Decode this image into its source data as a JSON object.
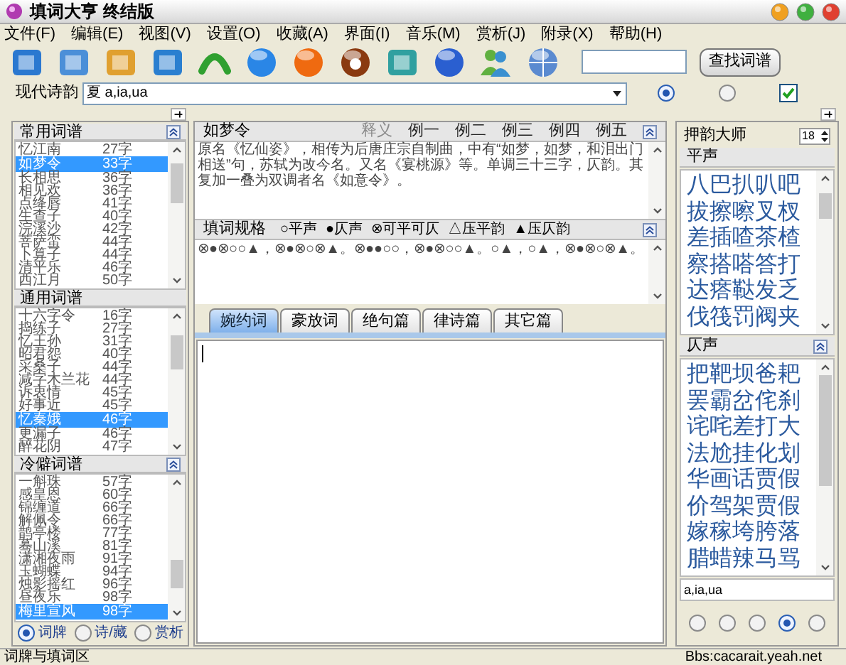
{
  "window": {
    "title": "填词大亨  终结版"
  },
  "menu": [
    "文件(F)",
    "编辑(E)",
    "视图(V)",
    "设置(O)",
    "收藏(A)",
    "界面(I)",
    "音乐(M)",
    "赏析(J)",
    "附录(X)",
    "帮助(H)"
  ],
  "toolbar": {
    "search_button": "查找词谱"
  },
  "rhyme_bar": {
    "label": "现代诗韵",
    "value": "夏 a,ia,ua",
    "options": [
      {
        "kind": "radio",
        "selected": true
      },
      {
        "kind": "radio",
        "selected": false
      },
      {
        "kind": "checkbox",
        "checked": true
      }
    ]
  },
  "left_groups": [
    {
      "title": "常用词谱",
      "items": [
        {
          "name": "忆江南",
          "count": "27字",
          "selected": false
        },
        {
          "name": "如梦令",
          "count": "33字",
          "selected": true
        },
        {
          "name": "长相思",
          "count": "36字",
          "selected": false
        },
        {
          "name": "相见欢",
          "count": "36字",
          "selected": false
        },
        {
          "name": "点绛唇",
          "count": "41字",
          "selected": false
        },
        {
          "name": "生查子",
          "count": "40字",
          "selected": false
        },
        {
          "name": "浣溪沙",
          "count": "42字",
          "selected": false
        },
        {
          "name": "菩萨蛮",
          "count": "44字",
          "selected": false
        },
        {
          "name": "卜算子",
          "count": "44字",
          "selected": false
        },
        {
          "name": "清平乐",
          "count": "46字",
          "selected": false
        },
        {
          "name": "西江月",
          "count": "50字",
          "selected": false
        }
      ]
    },
    {
      "title": "通用词谱",
      "items": [
        {
          "name": "十六字令",
          "count": "16字",
          "selected": false
        },
        {
          "name": "捣练子",
          "count": "27字",
          "selected": false
        },
        {
          "name": "忆王孙",
          "count": "31字",
          "selected": false
        },
        {
          "name": "昭君怨",
          "count": "40字",
          "selected": false
        },
        {
          "name": "采桑子",
          "count": "44字",
          "selected": false
        },
        {
          "name": "减字木兰花",
          "count": "44字",
          "selected": false
        },
        {
          "name": "诉衷情",
          "count": "45字",
          "selected": false
        },
        {
          "name": "好事近",
          "count": "45字",
          "selected": false
        },
        {
          "name": "忆秦娥",
          "count": "46字",
          "selected": true
        },
        {
          "name": "更漏子",
          "count": "46字",
          "selected": false
        },
        {
          "name": "醉花阴",
          "count": "47字",
          "selected": false
        }
      ]
    },
    {
      "title": "冷僻词谱",
      "items": [
        {
          "name": "一斛珠",
          "count": "57字",
          "selected": false
        },
        {
          "name": "感皇恩",
          "count": "60字",
          "selected": false
        },
        {
          "name": "锦缠道",
          "count": "66字",
          "selected": false
        },
        {
          "name": "解佩令",
          "count": "66字",
          "selected": false
        },
        {
          "name": "鹊亭楼",
          "count": "77字",
          "selected": false
        },
        {
          "name": "蓦山溪",
          "count": "81字",
          "selected": false
        },
        {
          "name": "潇湘夜雨",
          "count": "91字",
          "selected": false
        },
        {
          "name": "玉蝴蝶",
          "count": "94字",
          "selected": false
        },
        {
          "name": "烛影摇红",
          "count": "96字",
          "selected": false
        },
        {
          "name": "昼夜乐",
          "count": "98字",
          "selected": false
        },
        {
          "name": "梅里宣风",
          "count": "98字",
          "selected": true
        }
      ]
    }
  ],
  "left_modes": [
    {
      "label": "词牌",
      "selected": true
    },
    {
      "label": "诗/藏",
      "selected": false
    },
    {
      "label": "赏析",
      "selected": false
    }
  ],
  "detail": {
    "title": "如梦令",
    "tabs": [
      {
        "label": "释义",
        "selected": true
      },
      {
        "label": "例一",
        "selected": false
      },
      {
        "label": "例二",
        "selected": false
      },
      {
        "label": "例三",
        "selected": false
      },
      {
        "label": "例四",
        "selected": false
      },
      {
        "label": "例五",
        "selected": false
      }
    ],
    "text": "原名《忆仙姿》，相传为后唐庄宗自制曲，中有“如梦，如梦，和泪出门相送”句，苏轼为改今名。又名《宴桃源》等。单调三十三字，仄韵。其复加一叠为双调者名《如意令》。"
  },
  "pattern": {
    "title": "填词规格",
    "legend": [
      "○平声",
      "●仄声",
      "⊗可平可仄",
      "△压平韵",
      "▲压仄韵"
    ],
    "text": "⊗●⊗○○▲，⊗●⊗○⊗▲。⊗●●○○，⊗●⊗○○▲。○▲，○▲，⊗●⊗○⊗▲。"
  },
  "editor_tabs": [
    {
      "label": "婉约词",
      "selected": true
    },
    {
      "label": "豪放词",
      "selected": false
    },
    {
      "label": "绝句篇",
      "selected": false
    },
    {
      "label": "律诗篇",
      "selected": false
    },
    {
      "label": "其它篇",
      "selected": false
    }
  ],
  "rhyme_master": {
    "title": "押韵大师",
    "size": "18",
    "groups": [
      {
        "title": "平声",
        "lines": [
          "八巴扒叭吧",
          "拔擦嚓叉杈",
          "差插喳茶楂",
          "察搭嗒答打",
          "达瘩鞑发乏",
          "伐筏罚阀夹"
        ]
      },
      {
        "title": "仄声",
        "lines": [
          "把靶坝爸耙",
          "罢霸岔侘刹",
          "诧咤差打大",
          "法尬挂化划",
          "华画话贾假",
          "价驾架贾假",
          "嫁稼垮胯落",
          "腊蜡辣马骂"
        ]
      }
    ],
    "rhyme": "a,ia,ua",
    "modes": [
      {
        "selected": false
      },
      {
        "selected": false
      },
      {
        "selected": false
      },
      {
        "selected": true
      },
      {
        "selected": false
      }
    ]
  },
  "status_bar": {
    "left": "词牌与填词区",
    "right": "Bbs:cacarait.yeah.net"
  }
}
